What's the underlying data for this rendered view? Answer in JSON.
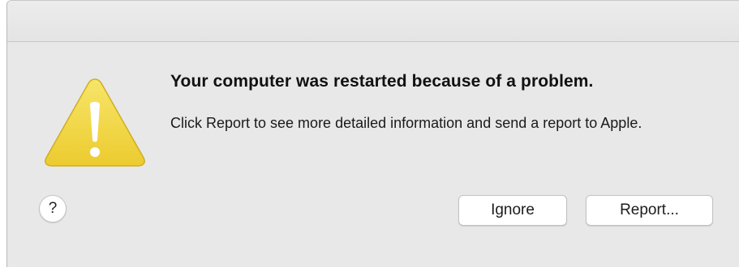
{
  "dialog": {
    "message": "Your computer was restarted because of a problem.",
    "informative_text": "Click Report to see more detailed information and send a report to Apple.",
    "icon": "caution-warning-icon",
    "help_label": "?",
    "buttons": {
      "ignore": "Ignore",
      "report": "Report..."
    }
  },
  "colors": {
    "warning_fill": "#f3d94a",
    "background": "#e8e8e8"
  }
}
